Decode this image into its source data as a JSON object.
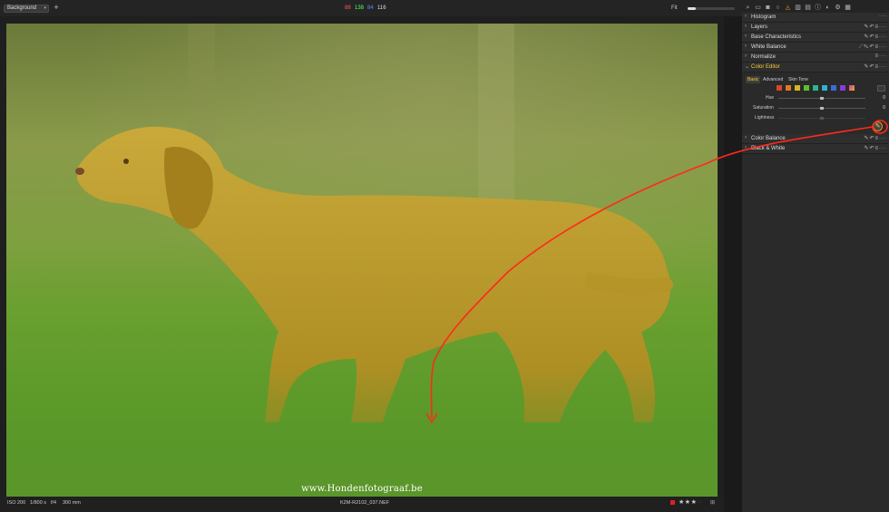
{
  "topbar": {
    "layer_select": "Background",
    "readouts": [
      {
        "value": "88",
        "color": "#ff5a5a"
      },
      {
        "value": "138",
        "color": "#5aff6a"
      },
      {
        "value": "84",
        "color": "#5a8aff"
      },
      {
        "value": "116",
        "color": "#dddddd"
      }
    ],
    "fit_label": "Fit",
    "tool_tabs": [
      "search-icon",
      "folder-icon",
      "camera-icon",
      "lens-icon",
      "color-icon",
      "levels-icon",
      "stack-icon",
      "info-icon",
      "adjust-icon",
      "gear-icon",
      "grid-icon"
    ]
  },
  "panel": {
    "tools": [
      {
        "title": "Histogram",
        "open": false
      },
      {
        "title": "Layers",
        "open": false
      },
      {
        "title": "Base Characteristics",
        "open": false
      },
      {
        "title": "White Balance",
        "open": false
      },
      {
        "title": "Normalize",
        "open": false
      },
      {
        "title": "Color Editor",
        "open": true
      },
      {
        "title": "Color Balance",
        "open": false
      },
      {
        "title": "Black & White",
        "open": false
      }
    ],
    "color_editor": {
      "tabs": [
        "Basic",
        "Advanced",
        "Skin Tone"
      ],
      "active_tab": "Basic",
      "swatches": [
        "#d9452a",
        "#e07a20",
        "#d6b51d",
        "#5fbf2a",
        "#2bb58c",
        "#2ab2d6",
        "#3a6bd6",
        "#8a3ad6",
        "#d63ab0",
        "#bdbdbd"
      ],
      "sliders": [
        {
          "label": "Hue",
          "value": "0",
          "position": 0.6
        },
        {
          "label": "Saturation",
          "value": "0",
          "position": 0.6
        },
        {
          "label": "Lightness",
          "value": "",
          "position": 0.6
        }
      ]
    }
  },
  "viewer": {
    "watermark": "www.Hondenfotograaf.be"
  },
  "statusbar": {
    "iso": "ISO 200",
    "shutter": "1/800 s",
    "aperture": "f/4",
    "focal": "300 mm",
    "filename": "K2M-R2102_037.NEF",
    "rating_stars": 3,
    "color_tag": "#e02020"
  }
}
